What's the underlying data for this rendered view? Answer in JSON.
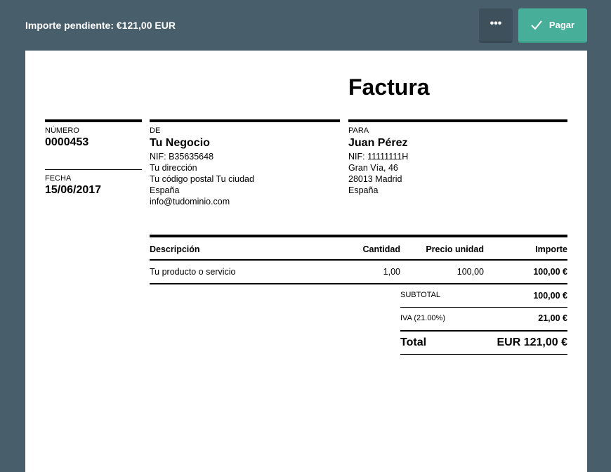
{
  "topbar": {
    "title": "Importe pendiente: €121,00 EUR",
    "more_label": "•••",
    "pay_label": "Pagar",
    "pay_icon": "check-icon"
  },
  "invoice": {
    "title": "Factura",
    "number_label": "NÚMERO",
    "number": "0000453",
    "date_label": "FECHA",
    "date": "15/06/2017",
    "from": {
      "label": "DE",
      "name": "Tu Negocio",
      "lines": [
        "NIF: B35635648",
        "Tu dirección",
        "Tu código postal Tu ciudad",
        "España",
        "info@tudominio.com"
      ]
    },
    "to": {
      "label": "PARA",
      "name": "Juan Pérez",
      "lines": [
        "NIF: 11111111H",
        "Gran Vía, 46",
        "28013 Madrid",
        "España"
      ]
    },
    "table": {
      "headers": [
        "Descripción",
        "Cantidad",
        "Precio unidad",
        "Importe"
      ],
      "rows": [
        [
          "Tu producto o servicio",
          "1,00",
          "100,00",
          "100,00 €"
        ]
      ]
    },
    "subtotal_label": "SUBTOTAL",
    "subtotal": "100,00 €",
    "tax_label": "IVA (21.00%)",
    "tax": "21,00 €",
    "total_label": "Total",
    "total": "EUR 121,00 €"
  }
}
